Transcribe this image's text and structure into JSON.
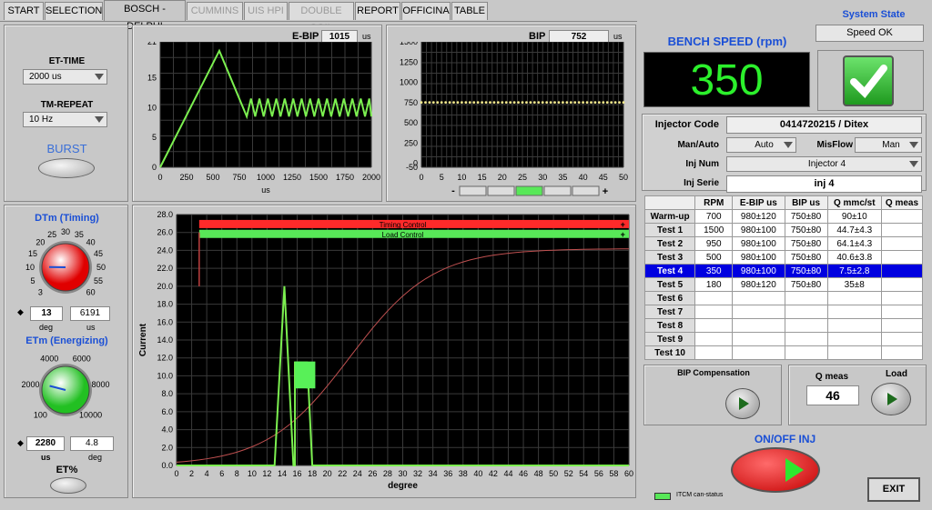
{
  "tabs": [
    "START",
    "SELECTION",
    "BOSCH - DELPHI",
    "CUMMINS",
    "UIS HPI",
    "DOUBLE COIL",
    "REPORT",
    "OFFICINA",
    "TABLE"
  ],
  "left": {
    "et_time_label": "ET-TIME",
    "et_time_value": "2000 us",
    "tm_repeat_label": "TM-REPEAT",
    "tm_repeat_value": "10 Hz",
    "burst_label": "BURST",
    "dtm_title": "DTm (Timing)",
    "dtm_ticks": [
      "3",
      "5",
      "10",
      "15",
      "20",
      "25",
      "30",
      "35",
      "40",
      "45",
      "50",
      "55",
      "60"
    ],
    "dtm_value": "13",
    "dtm_unit": "deg",
    "dtm_us_value": "6191",
    "dtm_us_unit": "us",
    "etm_title": "ETm (Energizing)",
    "etm_ticks": [
      "100",
      "2000",
      "4000",
      "6000",
      "8000",
      "10000"
    ],
    "etm_value": "2280",
    "etm_unit": "us",
    "etm_deg_value": "4.8",
    "etm_deg_unit": "deg",
    "et_pct_label": "ET%"
  },
  "ebip": {
    "label": "E-BIP",
    "value": "1015",
    "unit": "us",
    "x_unit": "us",
    "x_ticks": [
      "0",
      "250",
      "500",
      "750",
      "1000",
      "1250",
      "1500",
      "1750",
      "2000"
    ],
    "y_ticks": [
      "21",
      "15",
      "10",
      "5",
      "0"
    ]
  },
  "bip": {
    "label": "BIP",
    "value": "752",
    "unit": "us",
    "x_ticks": [
      "0",
      "5",
      "10",
      "15",
      "20",
      "25",
      "30",
      "35",
      "40",
      "45",
      "50"
    ],
    "y_ticks": [
      "1500",
      "1250",
      "1000",
      "750",
      "500",
      "250",
      "0",
      "-50"
    ],
    "minus": "-",
    "plus": "+"
  },
  "main_graph": {
    "y_label": "Current",
    "x_label": "degree",
    "y_ticks": [
      "28.0",
      "26.0",
      "24.0",
      "22.0",
      "20.0",
      "18.0",
      "16.0",
      "14.0",
      "12.0",
      "10.0",
      "8.0",
      "6.0",
      "4.0",
      "2.0",
      "0.0"
    ],
    "x_ticks": [
      "0",
      "2",
      "4",
      "6",
      "8",
      "10",
      "12",
      "14",
      "16",
      "18",
      "20",
      "22",
      "24",
      "26",
      "28",
      "30",
      "32",
      "34",
      "36",
      "38",
      "40",
      "42",
      "44",
      "46",
      "48",
      "50",
      "52",
      "54",
      "56",
      "58",
      "60"
    ],
    "timing_control": "Timing Control",
    "load_control": "Load Control"
  },
  "colors": {
    "bench_speed": "#1a4fd6",
    "trace": "#7cf050",
    "display": "#2cf02c",
    "highlight": "#0000e0"
  },
  "system_state_label": "System State",
  "system_state_value": "Speed OK",
  "bench_speed_label": "BENCH SPEED (rpm)",
  "bench_speed_value": "350",
  "injector_code_label": "Injector Code",
  "injector_code_value": "0414720215 / Ditex",
  "man_auto_label": "Man/Auto",
  "man_auto_value": "Auto",
  "misflow_label": "MisFlow",
  "misflow_value": "Man",
  "inj_num_label": "Inj Num",
  "inj_num_value": "Injector 4",
  "inj_serie_label": "Inj Serie",
  "inj_serie_value": "inj 4",
  "table": {
    "headers": [
      "",
      "RPM",
      "E-BIP us",
      "BIP us",
      "Q mmc/st",
      "Q meas"
    ],
    "rows": [
      [
        "Warm-up",
        "700",
        "980±120",
        "750±80",
        "90±10",
        ""
      ],
      [
        "Test 1",
        "1500",
        "980±100",
        "750±80",
        "44.7±4.3",
        ""
      ],
      [
        "Test 2",
        "950",
        "980±100",
        "750±80",
        "64.1±4.3",
        ""
      ],
      [
        "Test 3",
        "500",
        "980±100",
        "750±80",
        "40.6±3.8",
        ""
      ],
      [
        "Test 4",
        "350",
        "980±100",
        "750±80",
        "7.5±2.8",
        ""
      ],
      [
        "Test 5",
        "180",
        "980±120",
        "750±80",
        "35±8",
        ""
      ],
      [
        "Test 6",
        "",
        "",
        "",
        "",
        ""
      ],
      [
        "Test 7",
        "",
        "",
        "",
        "",
        ""
      ],
      [
        "Test 8",
        "",
        "",
        "",
        "",
        ""
      ],
      [
        "Test 9",
        "",
        "",
        "",
        "",
        ""
      ],
      [
        "Test 10",
        "",
        "",
        "",
        "",
        ""
      ]
    ],
    "highlight_row": 4
  },
  "bip_comp_label": "BIP Compensation",
  "q_meas_label": "Q meas",
  "q_meas_value": "46",
  "load_label": "Load",
  "onoff_label": "ON/OFF INJ",
  "itcm_label": "ITCM can-status",
  "exit_label": "EXIT"
}
